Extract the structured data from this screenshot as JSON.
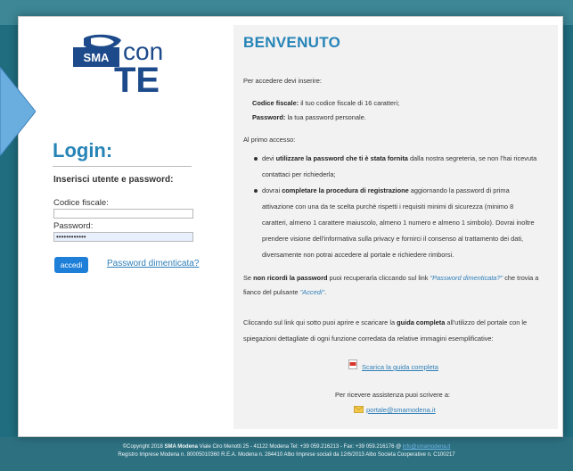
{
  "login": {
    "title": "Login:",
    "subtitle": "Inserisci utente e password:",
    "codice_label": "Codice fiscale:",
    "codice_value": "",
    "password_label": "Password:",
    "password_value": "••••••••••••",
    "submit_label": "accedi",
    "forgot_label": "Password dimenticata?"
  },
  "welcome": {
    "title": "BENVENUTO",
    "intro": "Per accedere devi inserire:",
    "field1_bold": "Codice fiscale:",
    "field1_rest": " il tuo codice fiscale di 16 caratteri;",
    "field2_bold": "Password:",
    "field2_rest": " la tua password personale.",
    "first_access": "Al primo accesso:",
    "b1_pre": "devi ",
    "b1_bold": "utilizzare la password che ti è stata fornita",
    "b1_post": " dalla nostra segreteria, se non l'hai ricevuta",
    "b1_line2": "contattaci per richiederla;",
    "b2_pre": "dovrai ",
    "b2_bold": "completare la procedura di registrazione",
    "b2_post": " aggiornando la password di prima",
    "b2_line2": "attivazione con una da te scelta purchè rispetti i requisiti minimi di sicurezza (minimo 8",
    "b2_line3": "caratteri, almeno 1 carattere maiuscolo, almeno 1 numero e almeno 1 simbolo). Dovrai inoltre",
    "b2_line4": "prendere visione dell'informativa sulla privacy e fornirci il consenso al trattamento dei dati,",
    "b2_line5": "diversamente non potrai accedere al portale e richiedere rimborsi.",
    "forgot_pre": "Se ",
    "forgot_bold": "non ricordi la password",
    "forgot_mid": " puoi recuperarla cliccando sul link ",
    "forgot_link": "\"Password dimenticata?\"",
    "forgot_post": " che trovia a",
    "forgot_line2_pre": "fianco del pulsante ",
    "forgot_line2_link": "\"Accedi\"",
    "forgot_line2_post": ".",
    "guide_pre": "Cliccando sul link qui sotto puoi aprire e scaricare la ",
    "guide_bold": "guida completa",
    "guide_post": " all'utilizzo del portale con le",
    "guide_line2": "spiegazioni dettagliate di ogni funzione corredata da relative immagini esemplificative:",
    "download_label": "Scarica la guida completa",
    "assist_text": "Per ricevere assistenza puoi scrivere a:",
    "email": "portale@smamodena.it"
  },
  "logo": {
    "sma": "SMA",
    "con": "con",
    "te": "TE"
  },
  "footer": {
    "line1_pre": "©Copyright 2018 ",
    "line1_bold": "SMA Modena",
    "line1_mid": " Viale Ciro Menotti 25 - 41122 Modena  Tel: +39 059.216213 - Fax: +39 059.216176  @ ",
    "line1_link": "info@smamodena.it",
    "line2": "Registro Imprese Modena n. 80005010360  R.E.A. Modena n. 284410  Albo Imprese sociali da 12/6/2013  Albo Societa Cooperative n. C100217"
  },
  "colors": {
    "accent": "#2684b7",
    "button": "#1e7fd8",
    "link": "#2e7fb8",
    "background": "#1f6d7e"
  }
}
